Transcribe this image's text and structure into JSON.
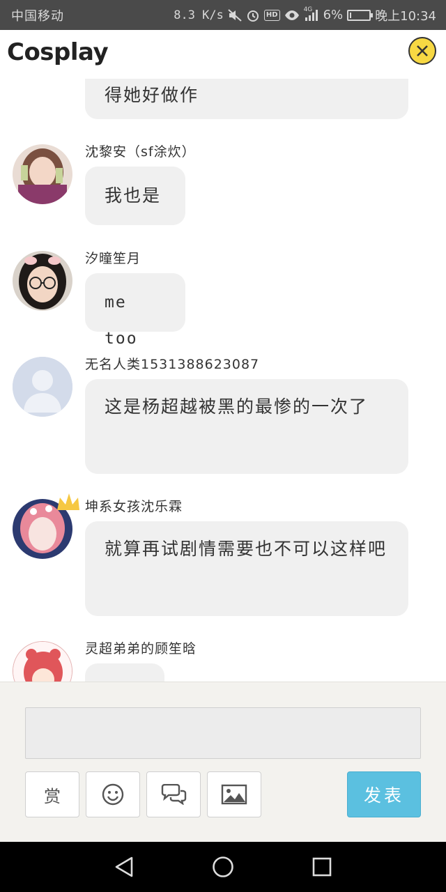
{
  "status_bar": {
    "carrier": "中国移动",
    "speed": "8.3 K/s",
    "hd_label": "HD",
    "network_label": "4G",
    "battery_text": "6%",
    "battery_level": 0.06,
    "time": "晚上10:34"
  },
  "header": {
    "title": "Cosplay"
  },
  "messages": [
    {
      "nickname": "",
      "text": "得她好做作",
      "avatar": "none"
    },
    {
      "nickname": "沈黎安（sf涂炊）",
      "text": "我也是",
      "avatar": "girl-photo-1"
    },
    {
      "nickname": "汐曈笙月",
      "text": "me  too",
      "avatar": "girl-photo-glasses"
    },
    {
      "nickname": "无名人类1531388623087",
      "text": "这是杨超越被黑的最惨的一次了",
      "avatar": "default-avatar"
    },
    {
      "nickname": "坤系女孩沈乐霖",
      "text": "就算再试剧情需要也不可以这样吧",
      "avatar": "girl-photo-crown"
    },
    {
      "nickname": "灵超弟弟的顾笙晗",
      "text": "",
      "avatar": "anime-avatar"
    }
  ],
  "composer": {
    "input_value": "",
    "reward_label": "赏",
    "emoji_icon": "smiley-icon",
    "comment_icon": "speech-bubbles-icon",
    "image_icon": "picture-icon",
    "send_label": "发表"
  },
  "colors": {
    "status_bar_bg": "#4a4a4a",
    "bubble_bg": "#f0f0f0",
    "send_button": "#5bc0e0",
    "close_button": "#f7d843",
    "composer_bg": "#f3f2ee"
  }
}
